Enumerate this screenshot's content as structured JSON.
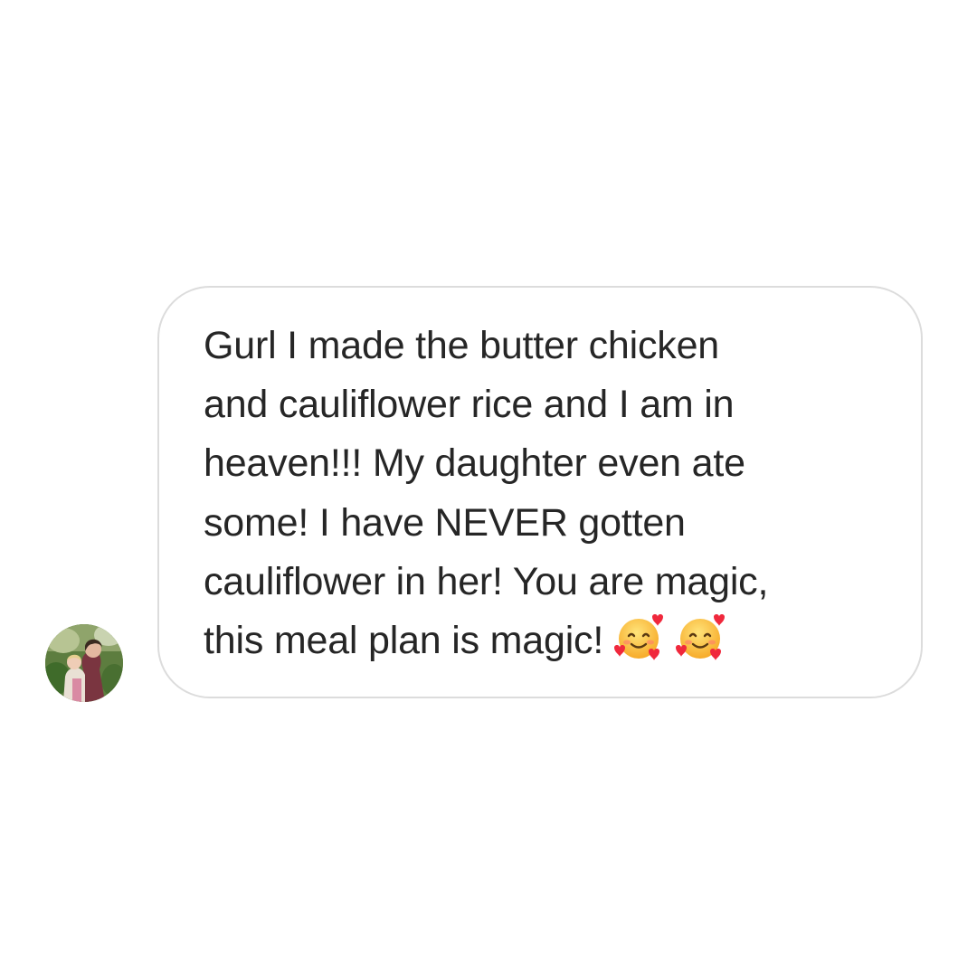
{
  "message": {
    "lines": [
      "Gurl I made the butter chicken",
      "and cauliflower rice and I am in",
      "heaven!!! My daughter even ate",
      "some! I have NEVER gotten",
      "cauliflower in her! You are magic,",
      "this meal plan is magic!"
    ],
    "emojis": [
      "smiling-face-with-hearts-icon",
      "smiling-face-with-hearts-icon"
    ]
  },
  "sender": {
    "avatar": "profile-photo"
  },
  "colors": {
    "text": "#262626",
    "bubble_border": "#dcdcdc",
    "background": "#ffffff"
  }
}
